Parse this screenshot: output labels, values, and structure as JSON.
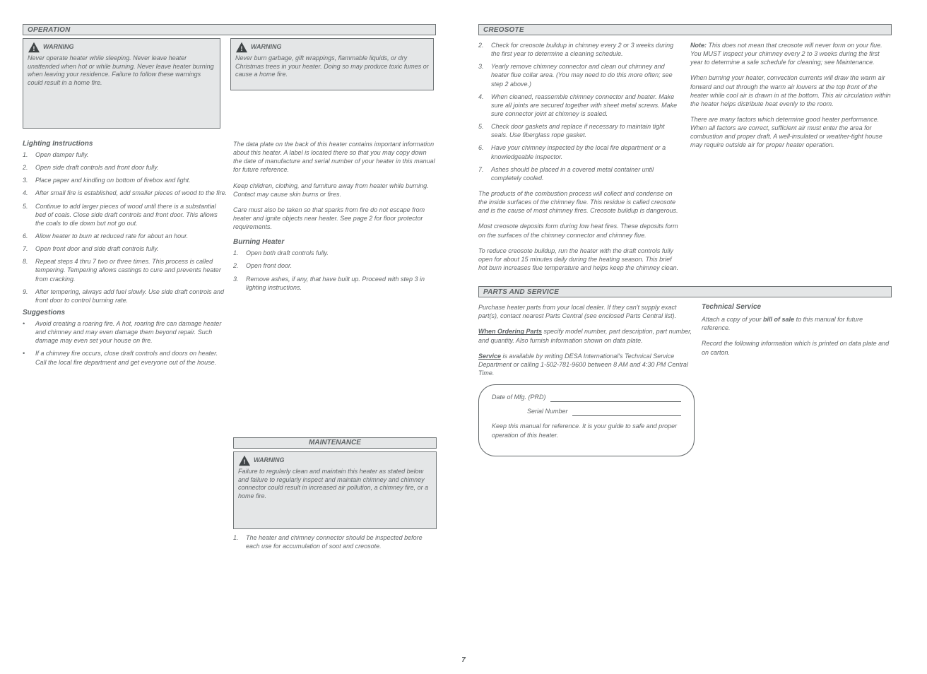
{
  "left": {
    "section_title": "OPERATION",
    "warn1": {
      "title": "WARNING",
      "body": "Never operate heater while sleeping. Never leave heater unattended when hot or while burning. Never leave heater burning when leaving your residence. Failure to follow these warnings could result in a home fire."
    },
    "warn2": {
      "title": "WARNING",
      "body": "Never burn garbage, gift wrappings, flammable liquids, or dry Christmas trees in your heater. Doing so may produce toxic fumes or cause a home fire."
    },
    "lighting_heading": "Lighting Instructions",
    "lighting_steps": [
      "Open damper fully.",
      "Open side draft controls and front door fully.",
      "Place paper and kindling on bottom of firebox and light.",
      "After small fire is established, add smaller pieces of wood to the fire.",
      "Continue to add larger pieces of wood until there is a substantial bed of coals. Close side draft controls and front door. This allows the coals to die down but not go out.",
      "Allow heater to burn at reduced rate for about an hour.",
      "Open front door and side draft controls fully.",
      "Repeat steps 4 thru 7 two or three times. This process is called tempering. Tempering allows castings to cure and prevents heater from cracking.",
      "After tempering, always add fuel slowly. Use side draft controls and front door to control burning rate."
    ],
    "suggestions_heading": "Suggestions",
    "bullets": [
      "Avoid creating a roaring fire. A hot, roaring fire can damage heater and chimney and may even damage them beyond repair. Such damage may even set your house on fire.",
      "If a chimney fire occurs, close draft controls and doors on heater. Call the local fire department and get everyone out of the house."
    ],
    "right_para1": "The data plate on the back of this heater contains important information about this heater. A label is located there so that you may copy down the date of manufacture and serial number of your heater in this manual for future reference.",
    "right_para2": "Keep children, clothing, and furniture away from heater while burning. Contact may cause skin burns or fires.",
    "right_para3": "Care must also be taken so that sparks from fire do not escape from heater and ignite objects near heater. See page 2 for floor protector requirements.",
    "burning_heading": "Burning Heater",
    "burning_steps": [
      "Open both draft controls fully.",
      "Open front door.",
      "Remove ashes, if any, that have built up. Proceed with step 3 in lighting instructions."
    ],
    "maint_title": "MAINTENANCE",
    "maint_warn": {
      "title": "WARNING",
      "body": "Failure to regularly clean and maintain this heater as stated below and failure to regularly inspect and maintain chimney and chimney connector could result in increased air pollution, a chimney fire, or a home fire."
    },
    "maint_steps": [
      "The heater and chimney connector should be inspected before each use for accumulation of soot and creosote.",
      "Check for creosote buildup in chimney every 2 or 3 weeks during the first year to determine a cleaning schedule.",
      "Yearly remove chimney connector and clean out chimney and heater flue collar area. (You may need to do this more often; see step 2 above.)",
      "When cleaned, reassemble chimney connector and heater. Make sure all joints are secured together with sheet metal screws. Make sure connector joint at chimney is sealed.",
      "Check door gaskets and replace if necessary to maintain tight seals. Use fiberglass rope gasket.",
      "Have your chimney inspected by the local fire department or a knowledgeable inspector.",
      "Ashes should be placed in a covered metal container until completely cooled."
    ]
  },
  "right": {
    "section_title": "CREOSOTE",
    "para1": "The products of the combustion process will collect and condense on the inside surfaces of the chimney flue. This residue is called creosote and is the cause of most chimney fires. Creosote buildup is dangerous.",
    "para2": "Most creosote deposits form during low heat fires. These deposits form on the surfaces of the chimney connector and chimney flue.",
    "para3": "To reduce creosote buildup, run the heater with the draft controls fully open for about 15 minutes daily during the heating season. This brief hot burn increases flue temperature and helps keep the chimney clean.",
    "note_label": "Note:",
    "note_body": "This does not mean that creosote will never form on your flue. You MUST inspect your chimney every 2 to 3 weeks during the first year to determine a safe schedule for cleaning; see Maintenance.",
    "para4": "When burning your heater, convection currents will draw the warm air forward and out through the warm air louvers at the top front of the heater while cool air is drawn in at the bottom. This air circulation within the heater helps distribute heat evenly to the room.",
    "para5": "There are many factors which determine good heater performance. When all factors are correct, sufficient air must enter the area for combustion and proper draft. A well-insulated or weather-tight house may require outside air for proper heater operation.",
    "service_title": "PARTS AND SERVICE",
    "service_p1": "Purchase heater parts from your local dealer. If they can't supply exact part(s), contact nearest Parts Central (see enclosed Parts Central list).",
    "service_p2_underline": "When Ordering Parts",
    "service_p2_body": " specify model number, part description, part number, and quantity. Also furnish information shown on data plate.",
    "service_p3_underline": "Service",
    "service_p3_body": " is available by writing DESA International's Technical Service Department or calling 1-502-781-9600 between 8 AM and 4:30 PM Central Time.",
    "tech_title": "Technical Service",
    "tech_p1a": "Attach a copy of your ",
    "tech_p1b": "bill of sale",
    "tech_p1c": " to this manual for future reference.",
    "tech_p2": "Record the following information which is printed on data plate and on carton.",
    "reg_mfg": "Date of Mfg. (PRD)",
    "reg_serial": "Serial Number",
    "reg_keep": "Keep this manual for reference. It is your guide to safe and proper operation of this heater."
  },
  "page_number": "7"
}
